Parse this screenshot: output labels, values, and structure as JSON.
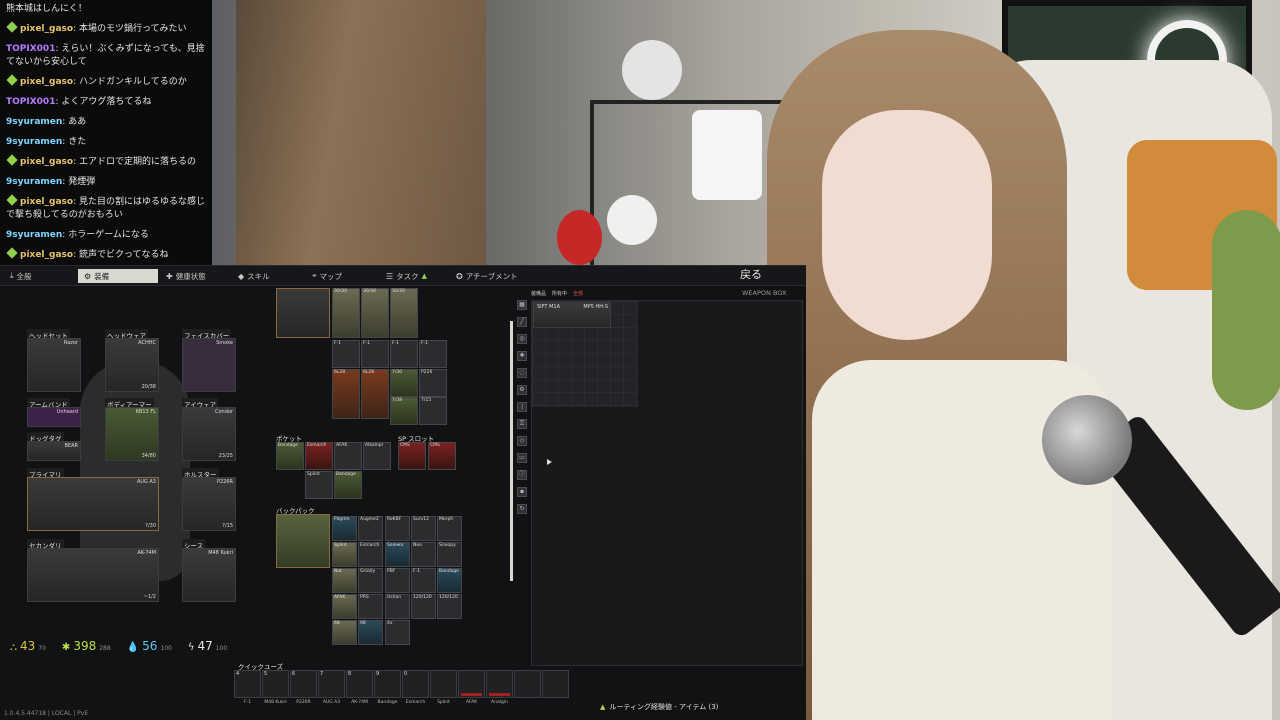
{
  "chat": {
    "messages": [
      {
        "user": "",
        "text": "熊本城はしんにく！",
        "badge": false,
        "color": "gold"
      },
      {
        "user": "pixel_gaso",
        "text": "本場のモツ鍋行ってみたい",
        "badge": true,
        "color": "gold"
      },
      {
        "user": "TOPIX001",
        "text": "えらい！ぶくみずになっても、見捨てないから安心して",
        "badge": false,
        "color": "purple"
      },
      {
        "user": "pixel_gaso",
        "text": "ハンドガンキルしてるのか",
        "badge": true,
        "color": "gold"
      },
      {
        "user": "TOPIX001",
        "text": "よくアウグ落ちてるね",
        "badge": false,
        "color": "purple"
      },
      {
        "user": "9syuramen",
        "text": "ああ",
        "badge": false,
        "color": "cyan"
      },
      {
        "user": "9syuramen",
        "text": "きた",
        "badge": false,
        "color": "cyan"
      },
      {
        "user": "pixel_gaso",
        "text": "エアドロで定期的に落ちるの",
        "badge": true,
        "color": "gold"
      },
      {
        "user": "9syuramen",
        "text": "発煙弾",
        "badge": false,
        "color": "cyan"
      },
      {
        "user": "pixel_gaso",
        "text": "見た目の割にはゆるゆるな感じで撃ち殺してるのがおもろい",
        "badge": true,
        "color": "gold"
      },
      {
        "user": "9syuramen",
        "text": "ホラーゲームになる",
        "badge": false,
        "color": "cyan"
      },
      {
        "user": "pixel_gaso",
        "text": "銃声でビクってなるね",
        "badge": true,
        "color": "gold"
      }
    ]
  },
  "game": {
    "tabs": [
      {
        "label": "全般",
        "icon": "download-icon"
      },
      {
        "label": "装備",
        "icon": "gear-icon"
      },
      {
        "label": "健康状態",
        "icon": "health-icon"
      },
      {
        "label": "スキル",
        "icon": "skill-icon"
      },
      {
        "label": "マップ",
        "icon": "map-pin-icon"
      },
      {
        "label": "タスク",
        "icon": "task-icon"
      },
      {
        "label": "アチーブメント",
        "icon": "achievement-icon"
      }
    ],
    "back": "戻る",
    "weapon_box": "WEAPON BOX",
    "equipment": {
      "headset": {
        "label": "ヘッドセット",
        "item": "Razor"
      },
      "headwear": {
        "label": "ヘッドウェア",
        "item": "ACHHC",
        "count": "20/38"
      },
      "face_cover": {
        "label": "フェイスカバー",
        "item": "Smoke"
      },
      "armband": {
        "label": "アームバンド",
        "item": "Unheard"
      },
      "body_armor": {
        "label": "ボディアーマー",
        "item": "6B13 FL",
        "count": "34/80"
      },
      "eyewear": {
        "label": "アイウェア",
        "item": "Condor",
        "count": "23/25"
      },
      "dogtag": {
        "label": "ドッグタグ",
        "item": "BEAR"
      },
      "primary": {
        "label": "プライマリ",
        "item": "AUG A3",
        "count": "?/30"
      },
      "holster": {
        "label": "ホルスター",
        "item": "P226R",
        "count": "?/15"
      },
      "secondary": {
        "label": "セカンダリ",
        "item": "AK-74M",
        "count": "~1/2"
      },
      "sheath": {
        "label": "シース",
        "item": "M48 Kukri"
      }
    },
    "sections": {
      "pockets": "ポケット",
      "sp_slots": "SP スロット",
      "backpack": "バックパック"
    },
    "rig_cells": [
      "30/30",
      "30/30",
      "30/30",
      "F-1",
      "F-1",
      "F-1",
      "F-1",
      "6L28",
      "6L28",
      "7/30",
      "7/38",
      "P226",
      "P226",
      "7/15"
    ],
    "pocket_cells": [
      "Bandage",
      "Esmarch",
      "AFAK",
      "Alkalnpl",
      "Splint",
      "Bandage"
    ],
    "sp_cells": [
      "CMS",
      "CMS"
    ],
    "backpack_cells": [
      "Pilgrim",
      "Augme2",
      "RoKBF",
      "Surv12",
      "Morph",
      "Splint",
      "Esmarch",
      "Salewa",
      "Neo",
      "Snoopy",
      "Nat",
      "Grizzly",
      "PBF",
      "F-1",
      "Bandage",
      "AFAK",
      "PRS",
      "Ushan",
      "120/120",
      "120/120",
      "68",
      "98",
      "4x"
    ],
    "stash_tabs": [
      "装備品",
      "所有中",
      "全部"
    ],
    "stash_item": "MP5 HH-S",
    "stash_item_label": "SIFT M1A",
    "stats": [
      {
        "icon": "weight-icon",
        "value": "43",
        "max": "70",
        "color": "#d9c43b"
      },
      {
        "icon": "energy-icon",
        "value": "398",
        "max": "288",
        "color": "#b9e14d"
      },
      {
        "icon": "hydration-icon",
        "value": "56",
        "max": "100",
        "color": "#5fc6f0"
      },
      {
        "icon": "lightning-icon",
        "value": "47",
        "max": "100",
        "color": "#e6e6e6"
      }
    ],
    "quick_use": "クイックユーズ",
    "quick_slots": [
      {
        "key": "4",
        "name": "F-1"
      },
      {
        "key": "5",
        "name": "M48 Kukri"
      },
      {
        "key": "6",
        "name": "P226R"
      },
      {
        "key": "7",
        "name": "AUG A3"
      },
      {
        "key": "8",
        "name": "AK-74M"
      },
      {
        "key": "9",
        "name": "Bandage"
      },
      {
        "key": "0",
        "name": "Esmarch"
      },
      {
        "key": "",
        "name": "Splint"
      },
      {
        "key": "",
        "name": "AFAK"
      },
      {
        "key": "",
        "name": "Analgin"
      },
      {
        "key": "",
        "name": ""
      },
      {
        "key": "",
        "name": ""
      }
    ],
    "version": "1.0.4.5.44718 | LOCAL | PvE",
    "notice": "ルーティング経験値 - アイテム (3)"
  }
}
